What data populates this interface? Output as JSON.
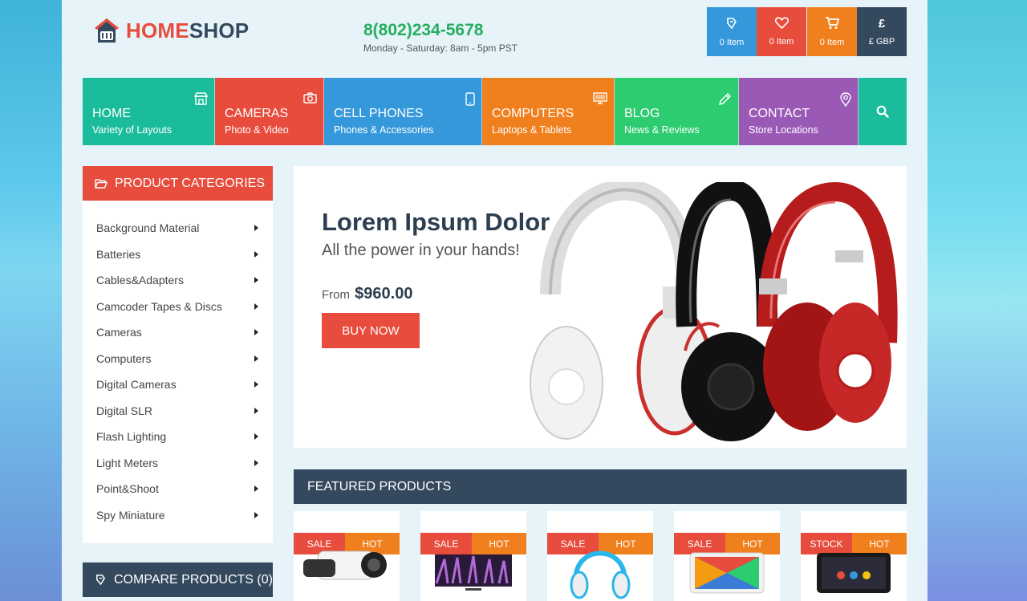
{
  "header": {
    "logo": {
      "part1": "HOME",
      "part2": "SHOP"
    },
    "phone": "8(802)234-5678",
    "hours": "Monday - Saturday: 8am - 5pm PST",
    "boxes": [
      {
        "icon": "compare-icon",
        "label": "0 Item"
      },
      {
        "icon": "heart-icon",
        "label": "0 Item"
      },
      {
        "icon": "cart-icon",
        "label": "0 Item"
      },
      {
        "icon": "pound-icon",
        "symbol": "£",
        "label": "£ GBP"
      }
    ]
  },
  "nav": [
    {
      "title": "HOME",
      "sub": "Variety of Layouts",
      "icon": "store-icon",
      "color": "#1abc9c"
    },
    {
      "title": "CAMERAS",
      "sub": "Photo & Video",
      "icon": "camera-icon",
      "color": "#e74c3c"
    },
    {
      "title": "CELL PHONES",
      "sub": "Phones & Accessories",
      "icon": "phone-icon",
      "color": "#3498db"
    },
    {
      "title": "COMPUTERS",
      "sub": "Laptops & Tablets",
      "icon": "monitor-icon",
      "color": "#f07f1e"
    },
    {
      "title": "BLOG",
      "sub": "News & Reviews",
      "icon": "pencil-icon",
      "color": "#2ecc71"
    },
    {
      "title": "CONTACT",
      "sub": "Store Locations",
      "icon": "map-pin-icon",
      "color": "#9b59b6"
    }
  ],
  "sidebar": {
    "categories_title": "PRODUCT CATEGORIES",
    "categories": [
      "Background Material",
      "Batteries",
      "Cables&Adapters",
      "Camcoder Tapes & Discs",
      "Cameras",
      "Computers",
      "Digital Cameras",
      "Digital SLR",
      "Flash Lighting",
      "Light Meters",
      "Point&Shoot",
      "Spy Miniature"
    ],
    "compare_title": "COMPARE PRODUCTS (0)"
  },
  "banner": {
    "title": "Lorem Ipsum Dolor",
    "subtitle": "All the power in your hands!",
    "from_label": "From",
    "price": "$960.00",
    "button": "BUY NOW"
  },
  "featured": {
    "title": "FEATURED PRODUCTS",
    "products": [
      {
        "tag1": "SALE",
        "tag2": "HOT"
      },
      {
        "tag1": "SALE",
        "tag2": "HOT"
      },
      {
        "tag1": "SALE",
        "tag2": "HOT"
      },
      {
        "tag1": "SALE",
        "tag2": "HOT"
      },
      {
        "tag1": "STOCK",
        "tag2": "HOT"
      }
    ]
  }
}
